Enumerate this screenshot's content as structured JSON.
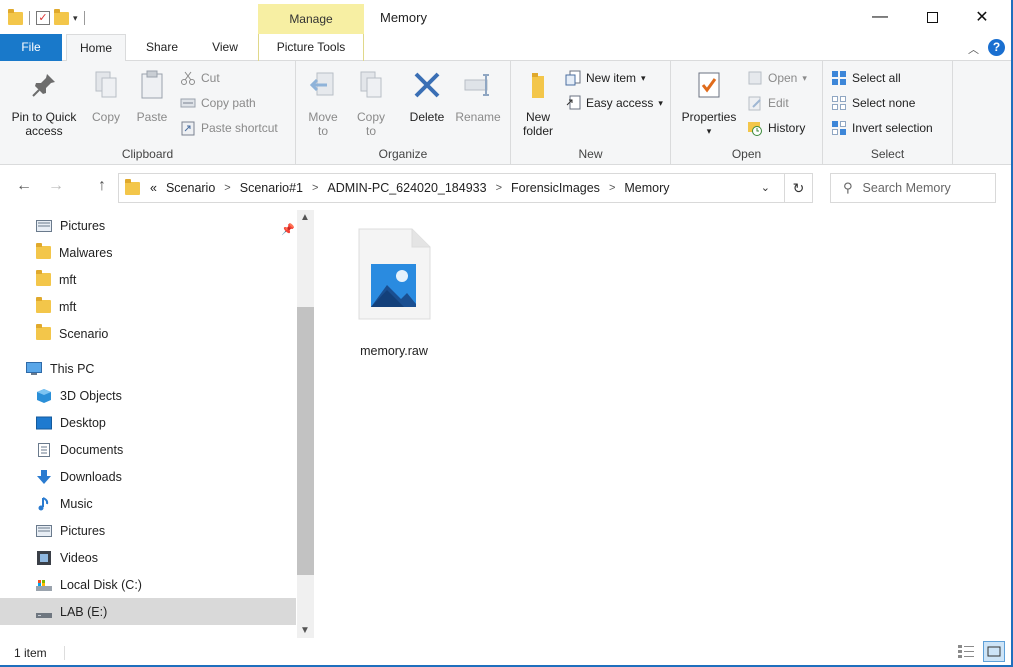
{
  "window": {
    "title": "Memory",
    "contextual_tab": "Manage",
    "minimize_glyph": "—",
    "close_glyph": "✕"
  },
  "tabs": {
    "file": "File",
    "home": "Home",
    "share": "Share",
    "view": "View",
    "picture_tools": "Picture Tools"
  },
  "ribbon": {
    "clipboard": {
      "label": "Clipboard",
      "pin": "Pin to Quick",
      "pin2": "access",
      "copy": "Copy",
      "paste": "Paste",
      "cut": "Cut",
      "copy_path": "Copy path",
      "paste_shortcut": "Paste shortcut"
    },
    "organize": {
      "label": "Organize",
      "move_to": "Move",
      "move_to2": "to",
      "copy_to": "Copy",
      "copy_to2": "to",
      "delete": "Delete",
      "rename": "Rename"
    },
    "new": {
      "label": "New",
      "new_folder": "New",
      "new_folder2": "folder",
      "new_item": "New item",
      "easy_access": "Easy access"
    },
    "open": {
      "label": "Open",
      "properties": "Properties",
      "open": "Open",
      "edit": "Edit",
      "history": "History"
    },
    "select": {
      "label": "Select",
      "select_all": "Select all",
      "select_none": "Select none",
      "invert_selection": "Invert selection"
    }
  },
  "address": {
    "overflow": "«",
    "crumbs": [
      "Scenario",
      "Scenario#1",
      "ADMIN-PC_624020_184933",
      "ForensicImages",
      "Memory"
    ],
    "search_placeholder": "Search Memory"
  },
  "nav_pane": {
    "items": [
      {
        "label": "Pictures",
        "icon": "pictures-icon"
      },
      {
        "label": "Malwares",
        "icon": "folder-icon"
      },
      {
        "label": "mft",
        "icon": "folder-icon"
      },
      {
        "label": "mft",
        "icon": "folder-icon"
      },
      {
        "label": "Scenario",
        "icon": "folder-icon"
      },
      {
        "label": "This PC",
        "icon": "computer-icon"
      },
      {
        "label": "3D Objects",
        "icon": "3d-objects-icon"
      },
      {
        "label": "Desktop",
        "icon": "desktop-icon"
      },
      {
        "label": "Documents",
        "icon": "documents-icon"
      },
      {
        "label": "Downloads",
        "icon": "downloads-icon"
      },
      {
        "label": "Music",
        "icon": "music-icon"
      },
      {
        "label": "Pictures",
        "icon": "pictures-icon"
      },
      {
        "label": "Videos",
        "icon": "videos-icon"
      },
      {
        "label": "Local Disk (C:)",
        "icon": "local-disk-icon"
      },
      {
        "label": "LAB (E:)",
        "icon": "drive-icon"
      }
    ],
    "selected": "LAB (E:)"
  },
  "content": {
    "files": [
      {
        "name": "memory.raw",
        "icon": "image-file-icon"
      }
    ]
  },
  "status": {
    "item_count": "1 item"
  },
  "colors": {
    "file_tab": "#1979ca",
    "manage_tab": "#f7efa3",
    "ribbon_bg": "#f5f6f7",
    "selected_nav": "#d9d9d9",
    "window_border": "#1f6fbd"
  }
}
